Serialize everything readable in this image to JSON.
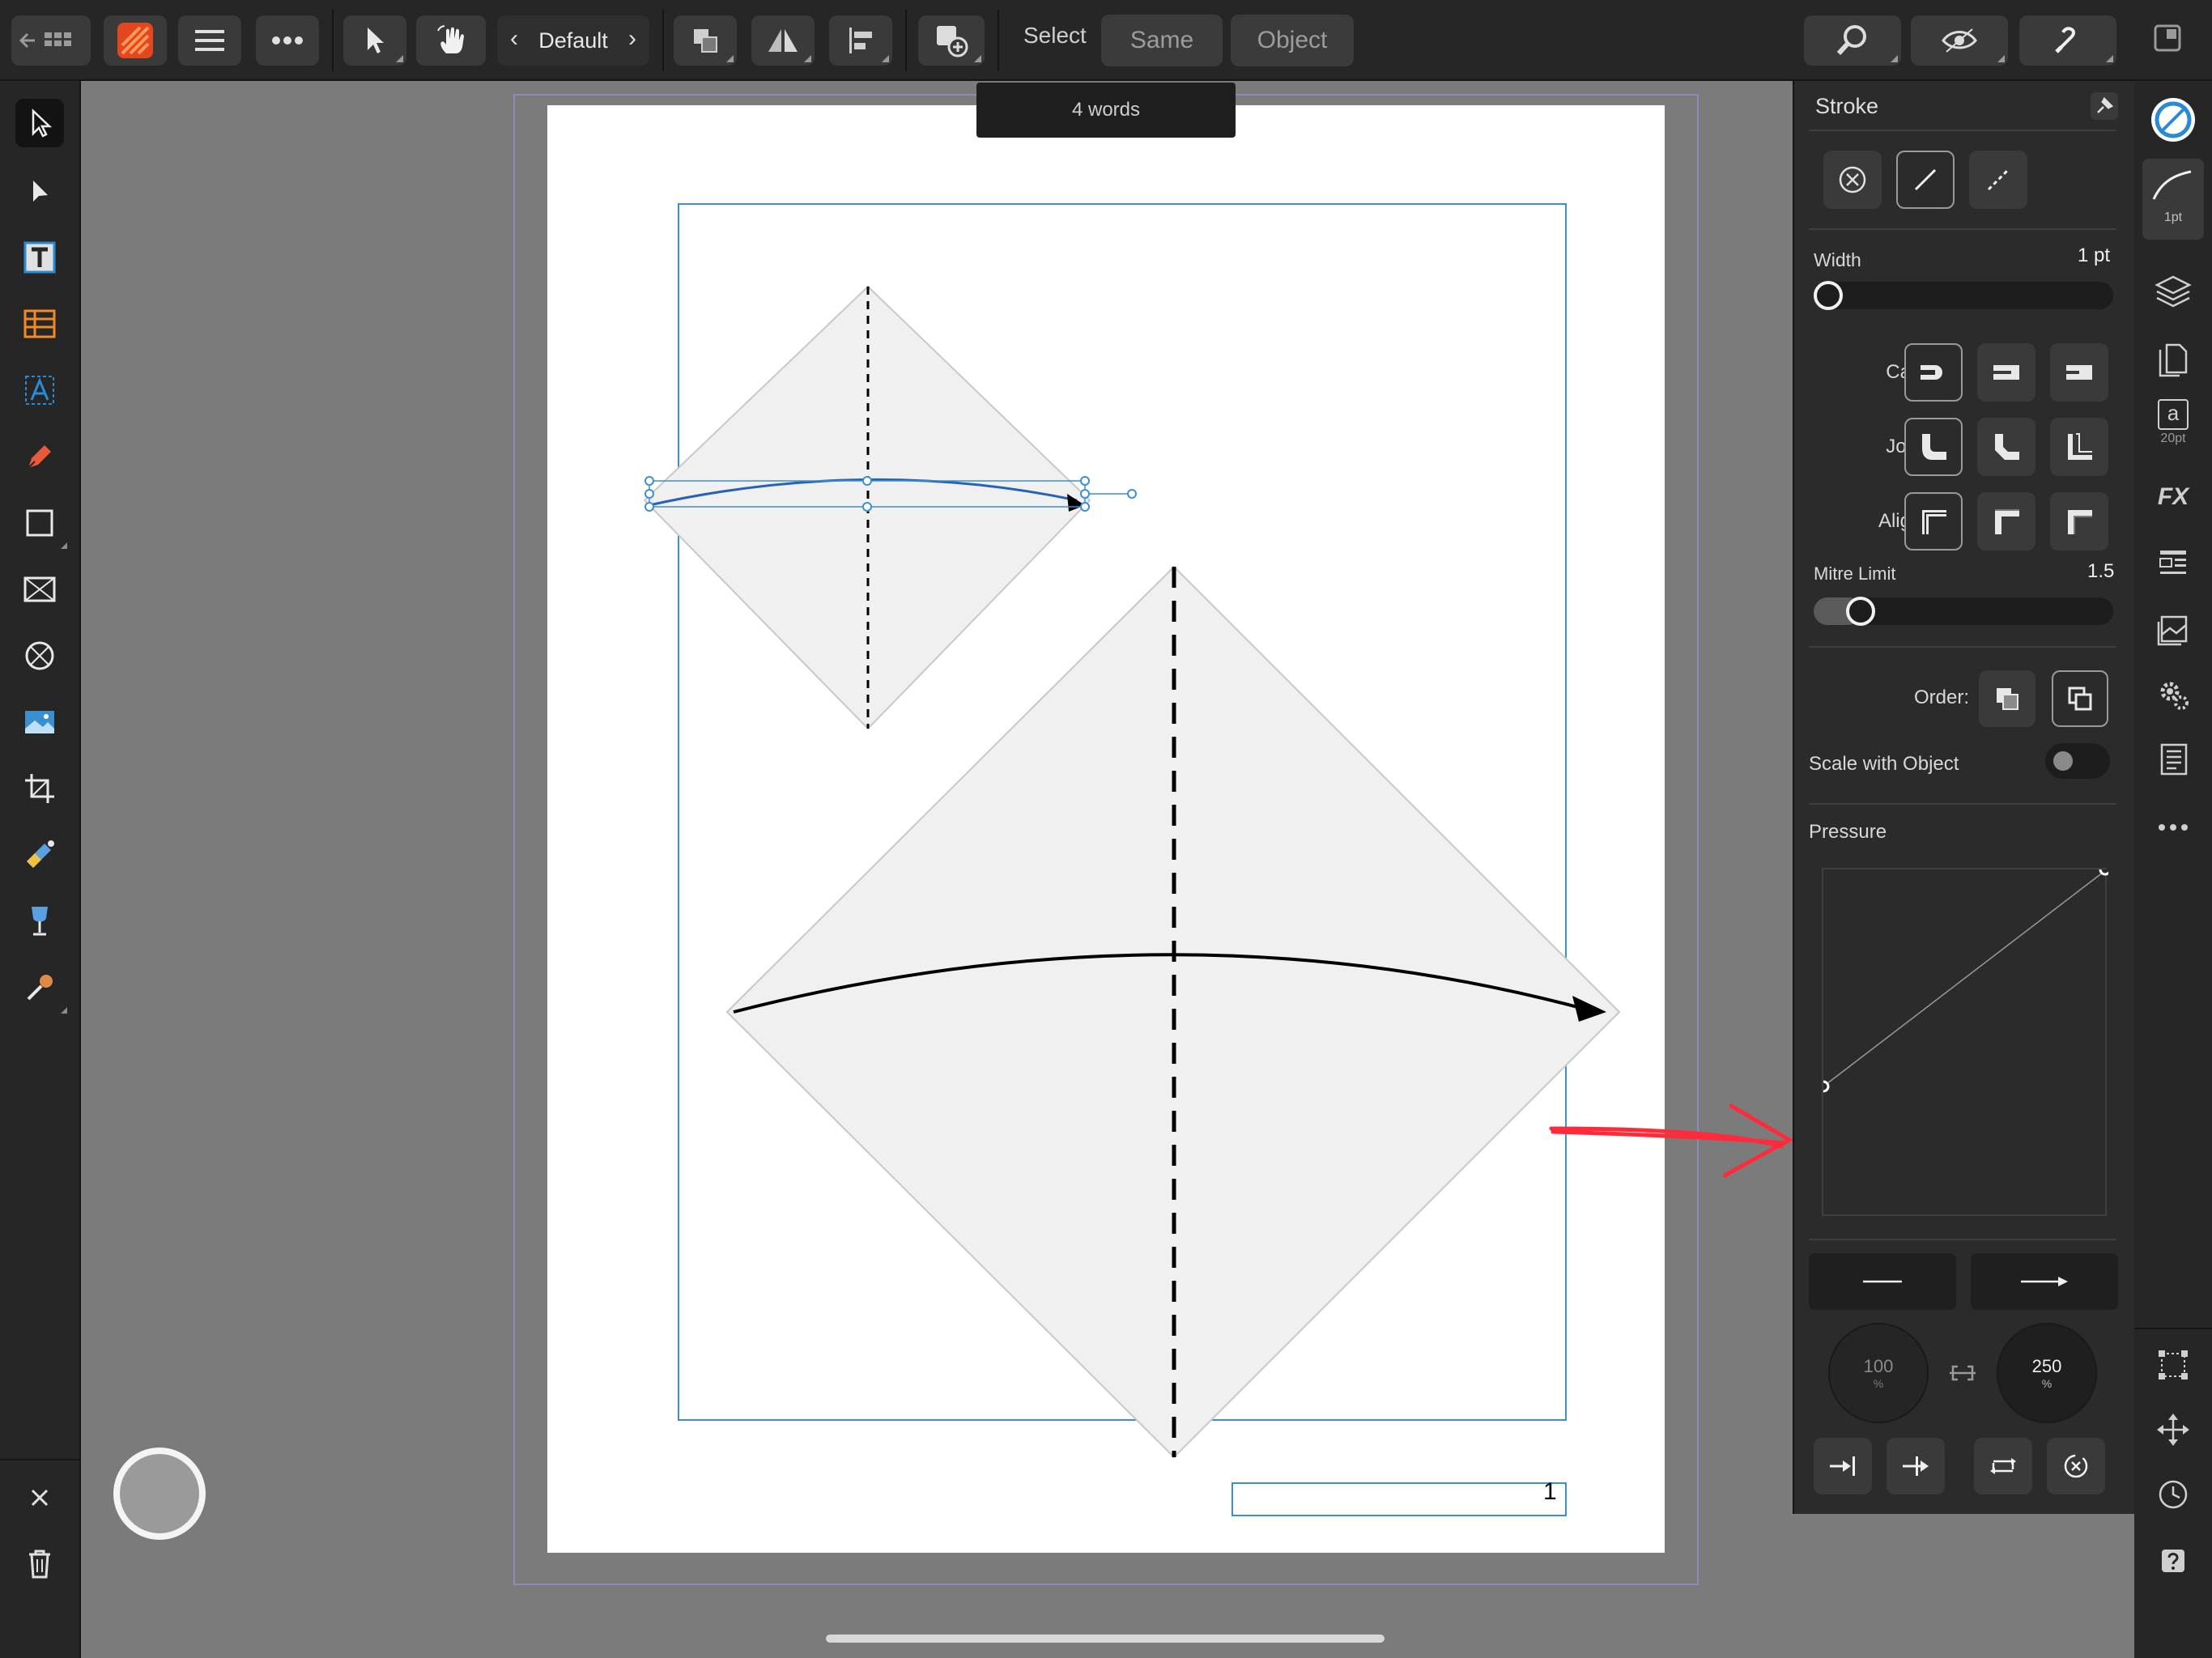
{
  "toolbar": {
    "context_label": "Default",
    "select_label": "Select",
    "same_button": "Same",
    "object_button": "Object"
  },
  "canvas": {
    "word_count_toast": "4 words",
    "page_number": "1"
  },
  "stroke_panel": {
    "title": "Stroke",
    "width_label": "Width",
    "width_value": "1 pt",
    "width_level": 0.02,
    "cap_label": "Cap:",
    "join_label": "Join:",
    "align_label": "Align:",
    "mitre_label": "Mitre Limit",
    "mitre_value": "1.5",
    "order_label": "Order:",
    "scale_label": "Scale with Object",
    "scale_enabled": false,
    "pressure_label": "Pressure",
    "start_scale": "100",
    "end_scale": "250",
    "percent_sign": "%"
  },
  "studio": {
    "stroke_badge": "1pt",
    "text_style_badge": "20pt",
    "text_style_glyph": "a",
    "fx_label": "FX"
  },
  "colors": {
    "accent_blue": "#1f6fc7",
    "annotation_red": "#ff2a3a",
    "panel_bg": "#2b2b2b",
    "canvas_bg": "#7b7b7b"
  }
}
